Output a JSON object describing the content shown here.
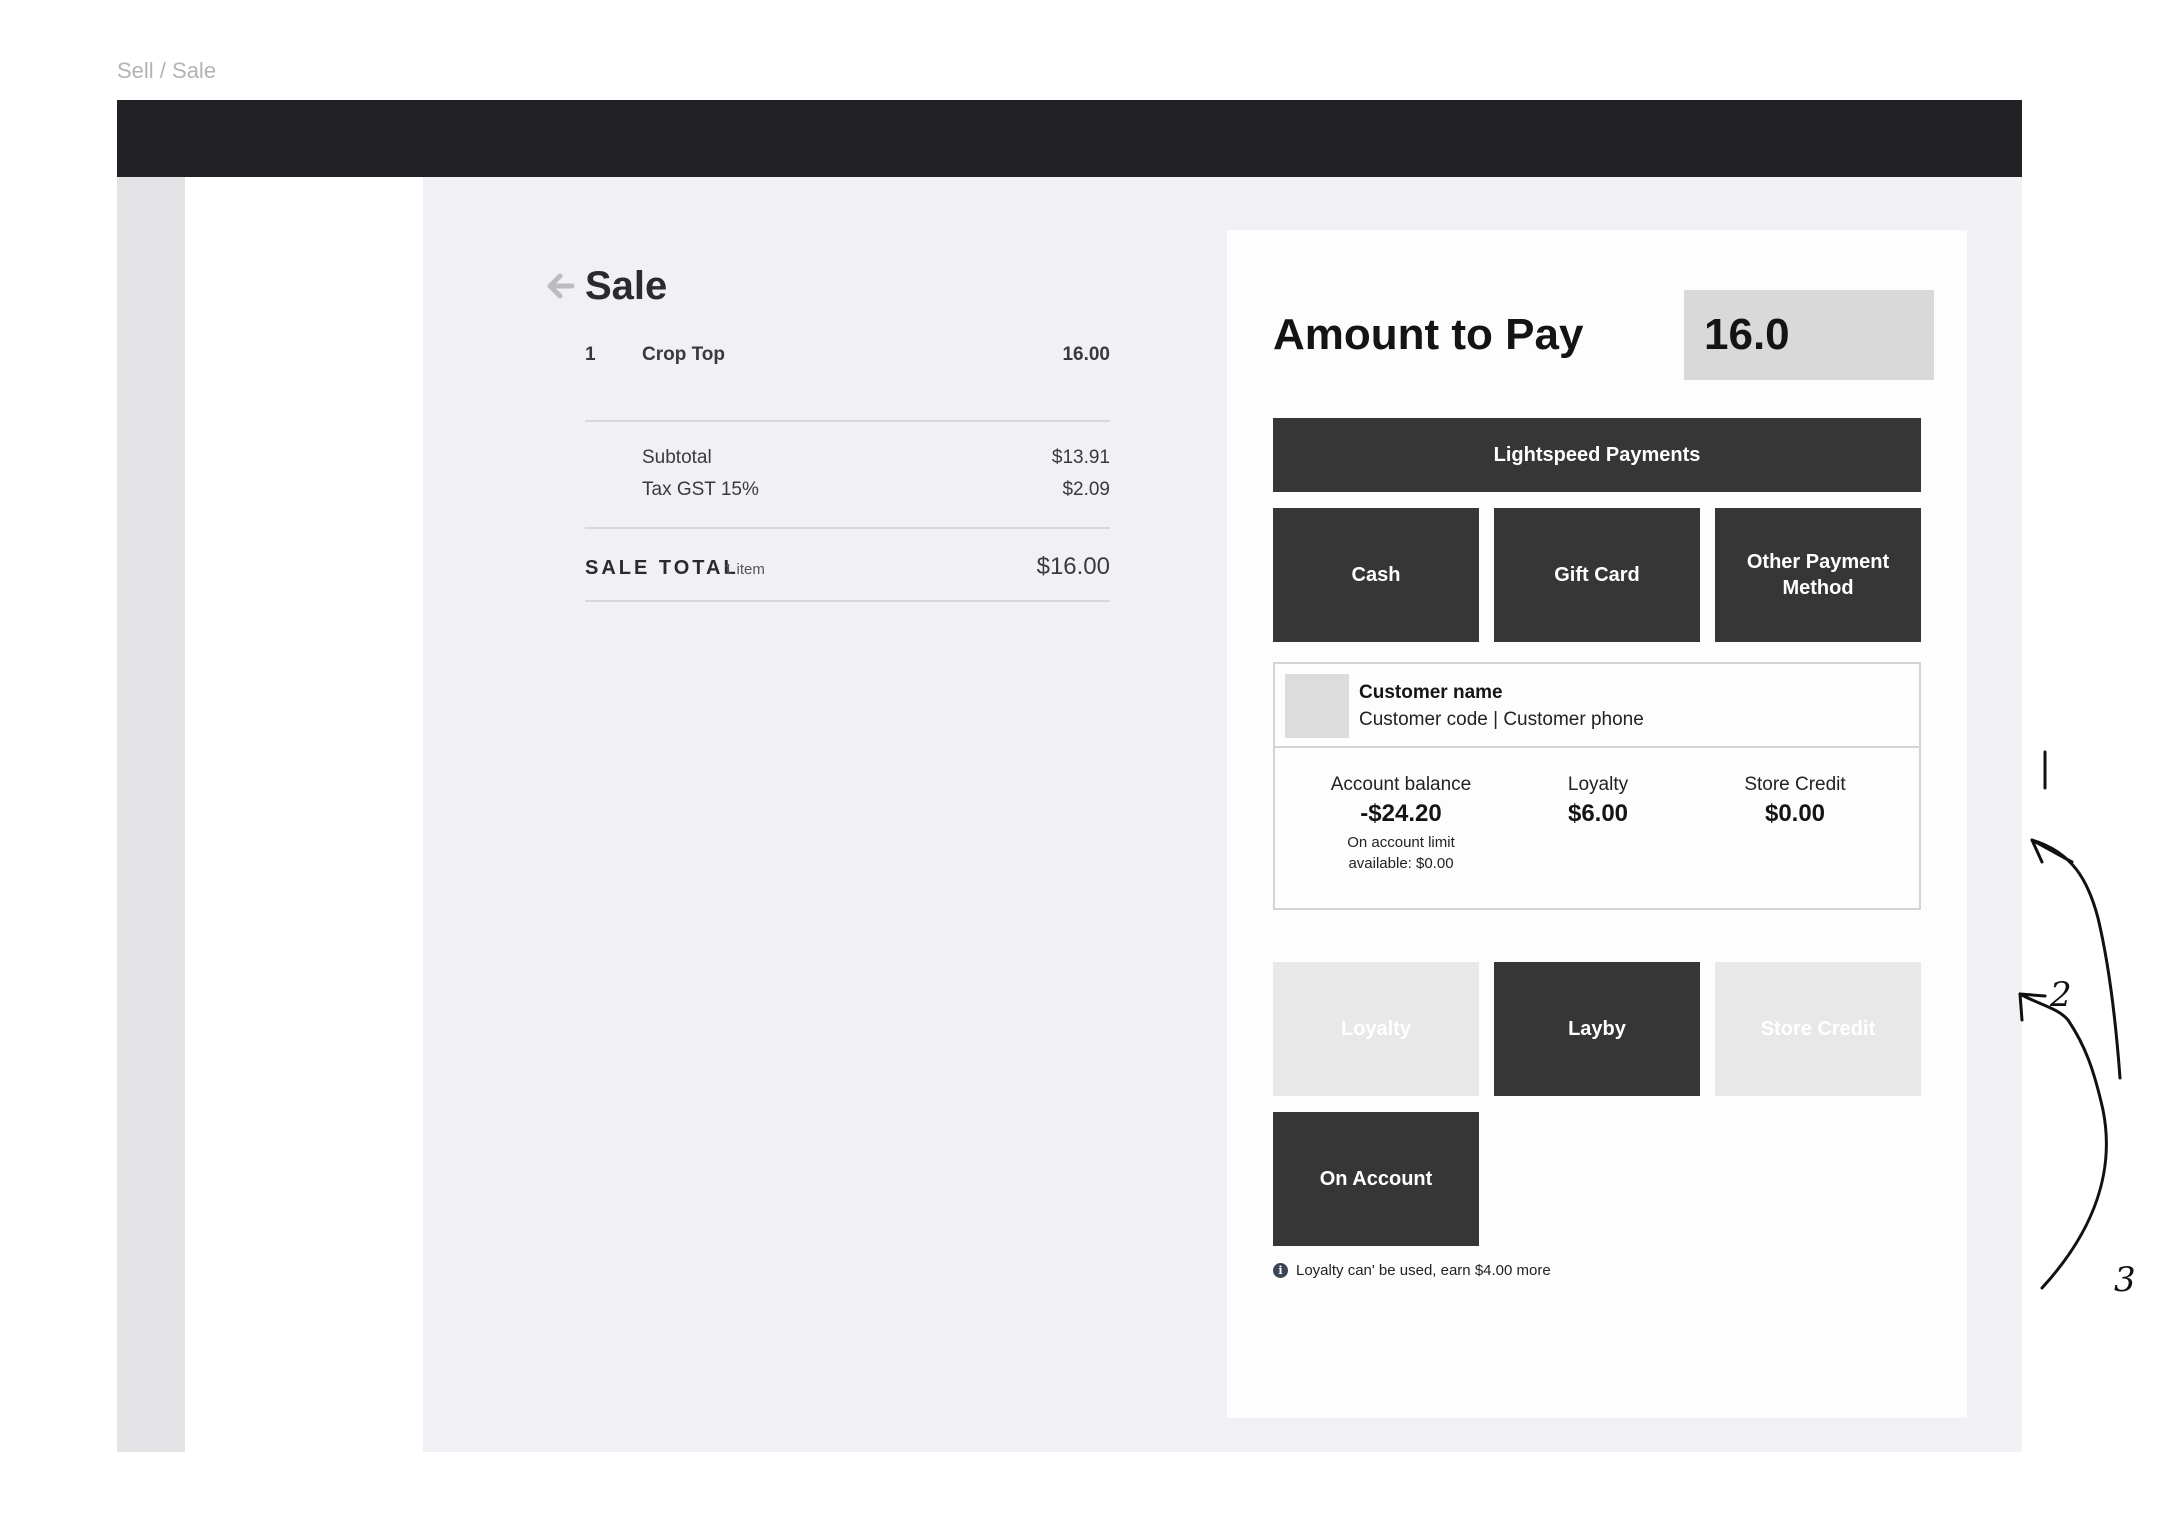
{
  "breadcrumb": "Sell / Sale",
  "sale": {
    "title": "Sale",
    "item": {
      "qty": "1",
      "name": "Crop Top",
      "price": "16.00"
    },
    "subtotal_label": "Subtotal",
    "subtotal_value": "$13.91",
    "tax_label": "Tax GST 15%",
    "tax_value": "$2.09",
    "total_label": "SALE TOTAL",
    "total_count": "1 item",
    "total_value": "$16.00"
  },
  "payment": {
    "amount_label": "Amount to Pay",
    "amount_value": "16.0",
    "lightspeed_label": "Lightspeed Payments",
    "cash_label": "Cash",
    "gift_card_label": "Gift Card",
    "other_label": "Other Payment Method",
    "loyalty_label": "Loyalty",
    "layby_label": "Layby",
    "store_credit_label": "Store Credit",
    "on_account_label": "On Account",
    "notice": "Loyalty can' be used, earn $4.00 more"
  },
  "customer": {
    "name": "Customer name",
    "sub": "Customer code | Customer phone",
    "account_balance_label": "Account balance",
    "account_balance_value": "-$24.20",
    "account_note_line1": "On account limit",
    "account_note_line2": "available: $0.00",
    "loyalty_label": "Loyalty",
    "loyalty_value": "$6.00",
    "store_credit_label": "Store Credit",
    "store_credit_value": "$0.00"
  },
  "annotations": {
    "one": "1",
    "two": "2",
    "three": "3"
  },
  "colors": {
    "topbar": "#222126",
    "button": "#363636",
    "button_disabled": "#e8e8e8",
    "canvas": "#f1f1f5"
  }
}
